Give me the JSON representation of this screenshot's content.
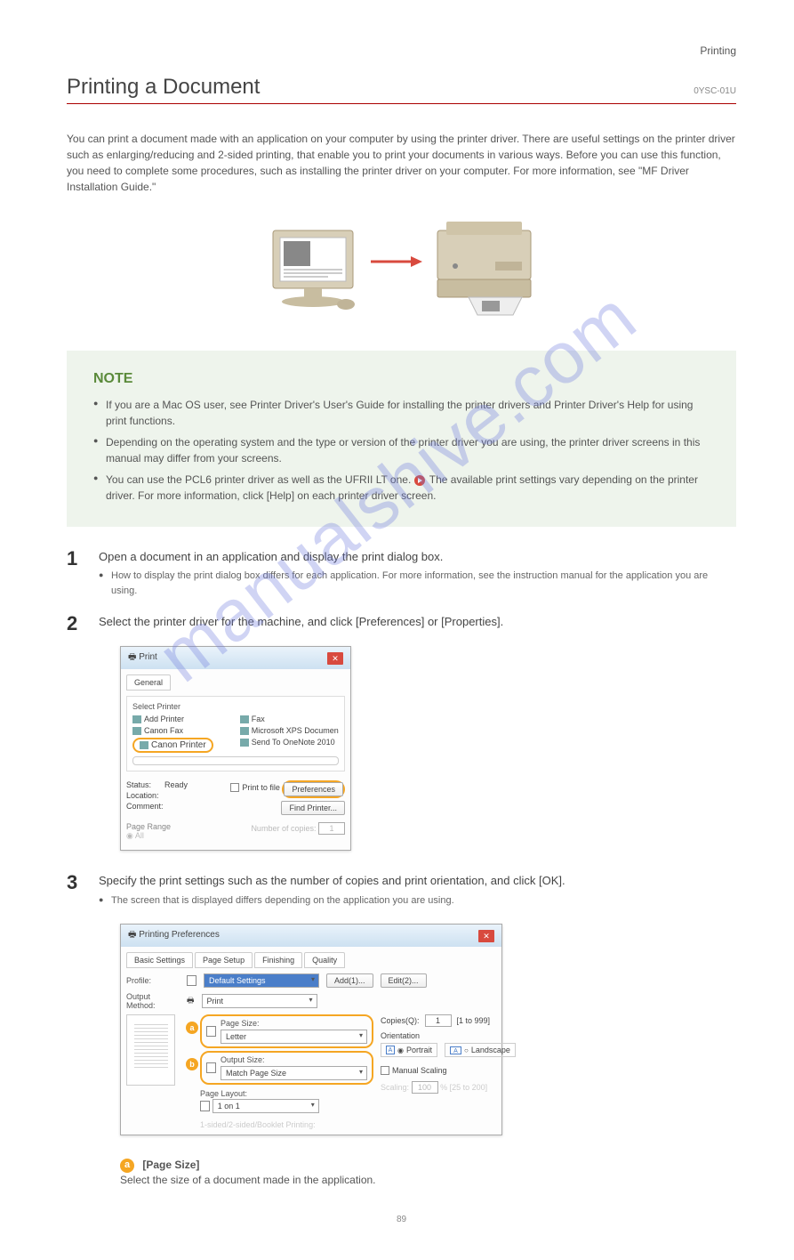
{
  "header": {
    "category": "Printing"
  },
  "title": {
    "text": "Printing a Document",
    "code": "0YSC-01U"
  },
  "intro": "You can print a document made with an application on your computer by using the printer driver. There are useful settings on the printer driver such as enlarging/reducing and 2-sided printing, that enable you to print your documents in various ways. Before you can use this function, you need to complete some procedures, such as installing the printer driver on your computer. For more information, see \"MF Driver Installation Guide.\"",
  "note": {
    "title": "NOTE",
    "items": [
      "If you are a Mac OS user, see Printer Driver's User's Guide for installing the printer drivers and Printer Driver's Help for using print functions.",
      "Depending on the operating system and the type or version of the printer driver you are using, the printer driver screens in this manual may differ from your screens.",
      {
        "text": "You can use the PCL6 printer driver as well as the UFRII LT one.",
        "extra": "The available print settings vary depending on the printer driver. For more information, click [Help] on each printer driver screen."
      }
    ]
  },
  "steps": {
    "s1": {
      "num": "1",
      "main": "Open a document in an application and display the print dialog box.",
      "sub": "How to display the print dialog box differs for each application. For more information, see the instruction manual for the application you are using."
    },
    "s2": {
      "num": "2",
      "main": "Select the printer driver for the machine, and click [Preferences] or [Properties]."
    },
    "s3": {
      "num": "3",
      "main": "Specify the print settings such as the number of copies and print orientation, and click [OK].",
      "sub": "The screen that is displayed differs depending on the application you are using."
    }
  },
  "print_dialog": {
    "title": "Print",
    "tab": "General",
    "select_printer": "Select Printer",
    "printers_left": [
      "Add Printer",
      "Canon Fax",
      "Canon Printer"
    ],
    "printers_right": [
      "Fax",
      "Microsoft XPS Documen",
      "Send To OneNote 2010"
    ],
    "status": {
      "label": "Status:",
      "value": "Ready"
    },
    "location": "Location:",
    "comment": "Comment:",
    "print_to_file": "Print to file",
    "preferences": "Preferences",
    "find_printer": "Find Printer...",
    "page_range": "Page Range",
    "all": "All",
    "num_copies": "Number of copies:",
    "num_copies_val": "1"
  },
  "prefs_dialog": {
    "title": "Printing Preferences",
    "tabs": [
      "Basic Settings",
      "Page Setup",
      "Finishing",
      "Quality"
    ],
    "profile_label": "Profile:",
    "profile_value": "Default Settings",
    "add_btn": "Add(1)...",
    "edit_btn": "Edit(2)...",
    "output_label": "Output Method:",
    "output_value": "Print",
    "page_size_label": "Page Size:",
    "page_size_value": "Letter",
    "output_size_label": "Output Size:",
    "output_size_value": "Match Page Size",
    "copies_label": "Copies(Q):",
    "copies_value": "1",
    "copies_range": "[1 to 999]",
    "orientation_label": "Orientation",
    "portrait": "Portrait",
    "landscape": "Landscape",
    "page_layout_label": "Page Layout:",
    "page_layout_value": "1 on 1",
    "manual_scaling": "Manual Scaling",
    "scaling_label": "Scaling:",
    "scaling_val": "100",
    "scaling_range": "% [25 to 200]",
    "sided_label": "1-sided/2-sided/Booklet Printing:"
  },
  "callout": {
    "label": "[Page Size]",
    "text": "Select the size of a document made in the application.",
    "badge": "a"
  },
  "page_number": "89",
  "watermark": "manualshive.com"
}
